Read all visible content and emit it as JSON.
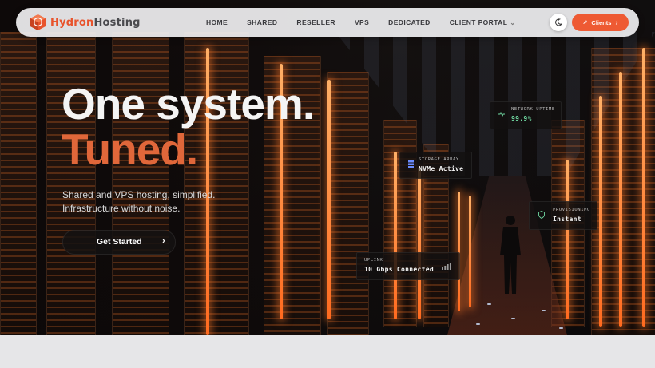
{
  "brand": {
    "name_a": "Hydron",
    "name_b": "Hosting"
  },
  "nav": {
    "items": [
      {
        "label": "HOME"
      },
      {
        "label": "SHARED"
      },
      {
        "label": "RESELLER"
      },
      {
        "label": "VPS"
      },
      {
        "label": "DEDICATED"
      },
      {
        "label": "CLIENT PORTAL"
      }
    ],
    "client_portal_icon": "chevron-down-icon",
    "theme_toggle_icon": "moon-icon",
    "clients_button": {
      "label": "Clients",
      "icon": "arrow-icon",
      "arrow_icon": "chevron-right-icon"
    }
  },
  "hero": {
    "title_line1": "One system.",
    "title_line2": "Tuned",
    "title_dot": ".",
    "subtitle_line1": "Shared and VPS hosting, simplified.",
    "subtitle_line2": "Infrastructure without noise.",
    "cta_label": "Get Started",
    "cta_icon": "chevron-right-icon"
  },
  "status_cards": {
    "network": {
      "label": "NETWORK UPTIME",
      "value": "99.9%",
      "icon": "pulse-icon"
    },
    "storage": {
      "label": "STORAGE ARRAY",
      "value": "NVMe Active",
      "icon": "database-icon"
    },
    "provisioning": {
      "label": "PROVISIONING",
      "value": "Instant",
      "icon": "shield-icon"
    },
    "uplink": {
      "label": "UPLINK",
      "value": "10 Gbps Connected",
      "icon": "signal-bars-icon"
    }
  },
  "colors": {
    "accent": "#ee5a33",
    "title_accent": "#e0673a",
    "uptime_green": "#6fd6a0"
  }
}
